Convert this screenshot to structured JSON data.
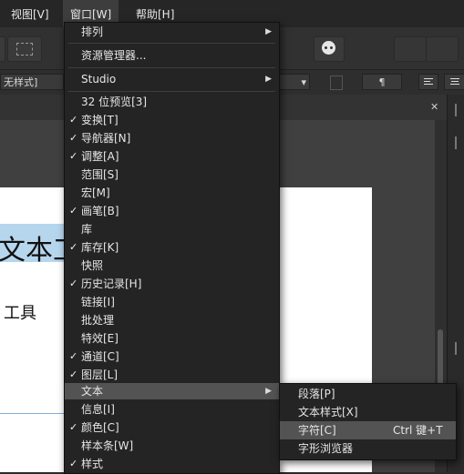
{
  "menubar": {
    "items": [
      {
        "label": "视图[V]"
      },
      {
        "label": "窗口[W]"
      },
      {
        "label": "帮助[H]"
      }
    ]
  },
  "context_bar": {
    "style_field": "无样式]",
    "pilcrow": "¶"
  },
  "canvas": {
    "heading_text": "文本工",
    "body_text": "工具"
  },
  "window_menu": {
    "items": [
      {
        "label": "排列",
        "checked": false,
        "submenu": true
      },
      {
        "label": "资源管理器...",
        "checked": false,
        "submenu": false
      },
      {
        "label": "Studio",
        "checked": false,
        "submenu": true
      },
      {
        "label": "32 位预览[3]",
        "checked": false,
        "submenu": false
      },
      {
        "label": "变换[T]",
        "checked": true,
        "submenu": false
      },
      {
        "label": "导航器[N]",
        "checked": true,
        "submenu": false
      },
      {
        "label": "调整[A]",
        "checked": true,
        "submenu": false
      },
      {
        "label": "范围[S]",
        "checked": false,
        "submenu": false
      },
      {
        "label": "宏[M]",
        "checked": false,
        "submenu": false
      },
      {
        "label": "画笔[B]",
        "checked": true,
        "submenu": false
      },
      {
        "label": "库",
        "checked": false,
        "submenu": false
      },
      {
        "label": "库存[K]",
        "checked": true,
        "submenu": false
      },
      {
        "label": "快照",
        "checked": false,
        "submenu": false
      },
      {
        "label": "历史记录[H]",
        "checked": true,
        "submenu": false
      },
      {
        "label": "链接[I]",
        "checked": false,
        "submenu": false
      },
      {
        "label": "批处理",
        "checked": false,
        "submenu": false
      },
      {
        "label": "特效[E]",
        "checked": false,
        "submenu": false
      },
      {
        "label": "通道[C]",
        "checked": true,
        "submenu": false
      },
      {
        "label": "图层[L]",
        "checked": true,
        "submenu": false
      },
      {
        "label": "文本",
        "checked": false,
        "submenu": true,
        "highlighted": true
      },
      {
        "label": "信息[I]",
        "checked": false,
        "submenu": false
      },
      {
        "label": "颜色[C]",
        "checked": true,
        "submenu": false
      },
      {
        "label": "样本条[W]",
        "checked": false,
        "submenu": false
      },
      {
        "label": "样式",
        "checked": true,
        "submenu": false
      }
    ]
  },
  "text_submenu": {
    "items": [
      {
        "label": "段落[P]",
        "shortcut": ""
      },
      {
        "label": "文本样式[X]",
        "shortcut": ""
      },
      {
        "label": "字符[C]",
        "shortcut": "Ctrl 键+T",
        "highlighted": true
      },
      {
        "label": "字形浏览器",
        "shortcut": ""
      }
    ]
  },
  "symbols": {
    "check": "✓",
    "arrow": "▶",
    "close": "✕",
    "dropdown": "▾"
  },
  "colors": {
    "menu_bg": "#242424",
    "highlight": "#535353",
    "selection": "#b6d6ee"
  }
}
